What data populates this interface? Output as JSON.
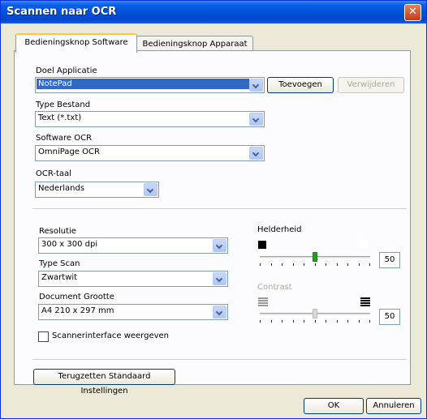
{
  "window": {
    "title": "Scannen naar OCR"
  },
  "tabs": [
    {
      "label": "Bedieningsknop Software"
    },
    {
      "label": "Bedieningsknop Apparaat"
    }
  ],
  "doel": {
    "label": "Doel Applicatie",
    "value": "NotePad",
    "add_label": "Toevoegen",
    "remove_label": "Verwijderen"
  },
  "bestand": {
    "label": "Type Bestand",
    "value": "Text (*.txt)"
  },
  "software": {
    "label": "Software OCR",
    "value": "OmniPage OCR"
  },
  "taal": {
    "label": "OCR-taal",
    "value": "Nederlands"
  },
  "resolutie": {
    "label": "Resolutie",
    "value": "300 x 300 dpi"
  },
  "scan": {
    "label": "Type Scan",
    "value": "Zwartwit"
  },
  "grootte": {
    "label": "Document Grootte",
    "value": "A4 210 x 297 mm"
  },
  "interface": {
    "label": "Scannerinterface weergeven",
    "checked": false
  },
  "helderheid": {
    "label": "Helderheid",
    "value": "50",
    "fraction": 0.5
  },
  "contrast": {
    "label": "Contrast",
    "value": "50",
    "fraction": 0.5
  },
  "reset_label": "Terugzetten Standaard Instellingen",
  "ok_label": "OK",
  "cancel_label": "Annuleren"
}
